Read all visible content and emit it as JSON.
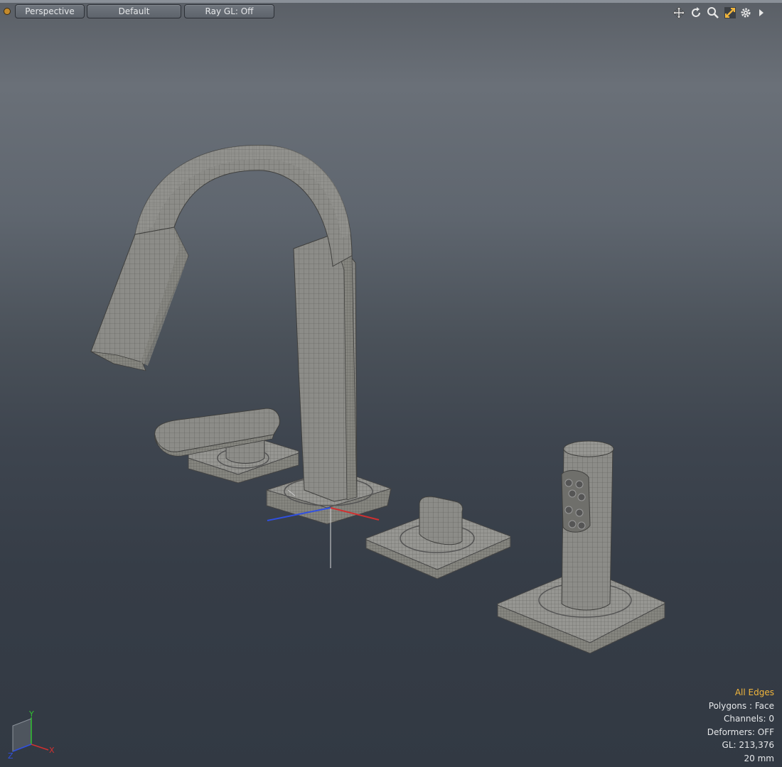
{
  "toolbar": {
    "view_mode": "Perspective",
    "shading": "Default",
    "raygl": "Ray GL: Off",
    "icons": [
      "move-view-icon",
      "rotate-view-icon",
      "zoom-view-icon",
      "maximize-view-icon",
      "settings-icon",
      "expand-arrow-icon"
    ]
  },
  "hud": {
    "selection_mode": "All Edges",
    "polygons": "Polygons : Face",
    "channels": "Channels: 0",
    "deformers": "Deformers: OFF",
    "gl": "GL: 213,376",
    "scale": "20 mm"
  },
  "axis": {
    "x": "X",
    "y": "Y",
    "z": "Z"
  },
  "colors": {
    "accent": "#f2b63c",
    "axis_x": "#d03030",
    "axis_y": "#30c030",
    "axis_z": "#3050e0",
    "mesh": "#8a8a86"
  },
  "scene_objects": [
    "faucet-spout",
    "left-handle",
    "right-handle",
    "hand-shower"
  ]
}
